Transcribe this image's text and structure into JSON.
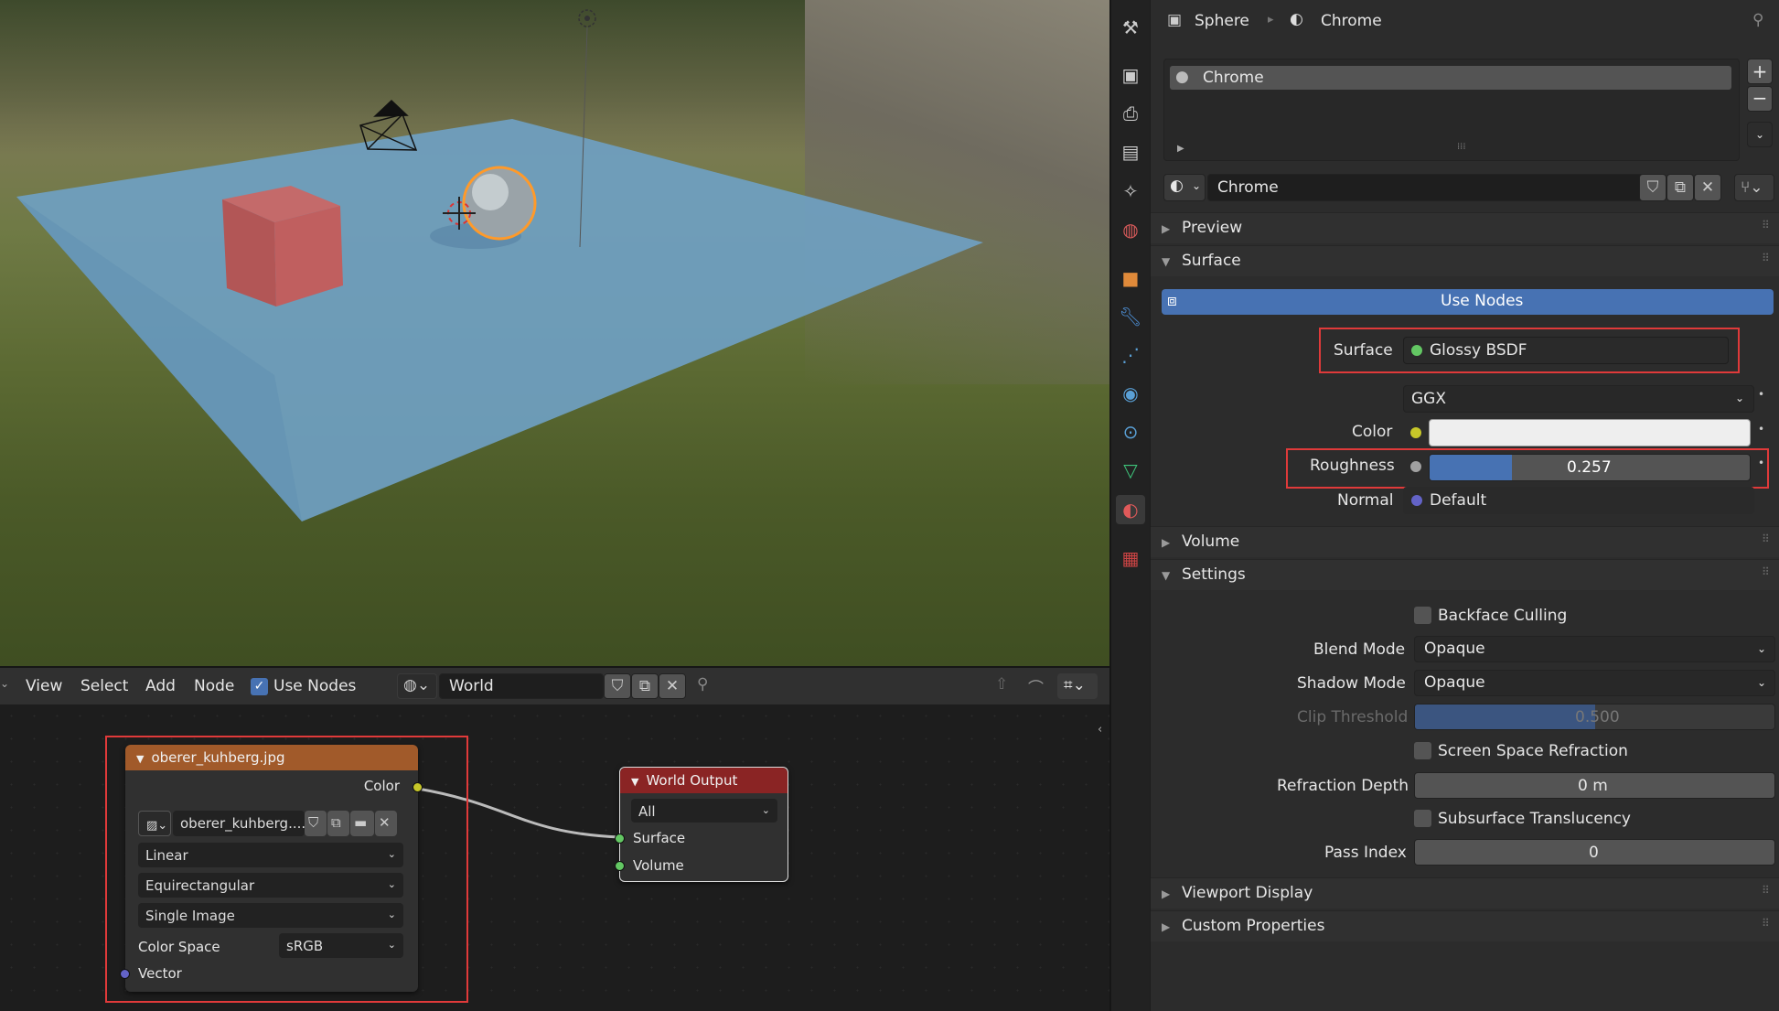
{
  "header": {
    "object_name": "Sphere",
    "material_name": "Chrome"
  },
  "material_slots": {
    "items": [
      "Chrome"
    ]
  },
  "material_selector": {
    "name": "Chrome"
  },
  "panels": {
    "preview": "Preview",
    "surface": "Surface",
    "volume": "Volume",
    "settings": "Settings",
    "viewport_display": "Viewport Display",
    "custom_properties": "Custom Properties"
  },
  "surface": {
    "use_nodes_label": "Use Nodes",
    "surface_label": "Surface",
    "surface_value": "Glossy BSDF",
    "distribution": "GGX",
    "color_label": "Color",
    "roughness_label": "Roughness",
    "roughness_value": "0.257",
    "roughness_fraction": 0.257,
    "normal_label": "Normal",
    "normal_value": "Default"
  },
  "settings": {
    "backface_culling": "Backface Culling",
    "blend_mode_label": "Blend Mode",
    "blend_mode_value": "Opaque",
    "shadow_mode_label": "Shadow Mode",
    "shadow_mode_value": "Opaque",
    "clip_threshold_label": "Clip Threshold",
    "clip_threshold_value": "0.500",
    "clip_threshold_fraction": 0.5,
    "ssr": "Screen Space Refraction",
    "refraction_depth_label": "Refraction Depth",
    "refraction_depth_value": "0 m",
    "subsurface": "Subsurface Translucency",
    "pass_index_label": "Pass Index",
    "pass_index_value": "0"
  },
  "node_editor": {
    "menu": [
      "View",
      "Select",
      "Add",
      "Node"
    ],
    "use_nodes": "Use Nodes",
    "world_name": "World",
    "image_node": {
      "title": "oberer_kuhberg.jpg",
      "output": "Color",
      "image_field": "oberer_kuhberg....",
      "interpolation": "Linear",
      "projection": "Equirectangular",
      "source": "Single Image",
      "color_space_label": "Color Space",
      "color_space_value": "sRGB",
      "input": "Vector"
    },
    "output_node": {
      "title": "World Output",
      "target": "All",
      "surface": "Surface",
      "volume": "Volume"
    }
  },
  "colors": {
    "accent_blue": "#4772b3",
    "node_header_image": "#a15a2a",
    "node_header_output": "#8a2424",
    "highlight_red": "#e03a3a",
    "socket_yellow": "#c7c729",
    "socket_green": "#63c763",
    "socket_purple": "#6363c7"
  }
}
